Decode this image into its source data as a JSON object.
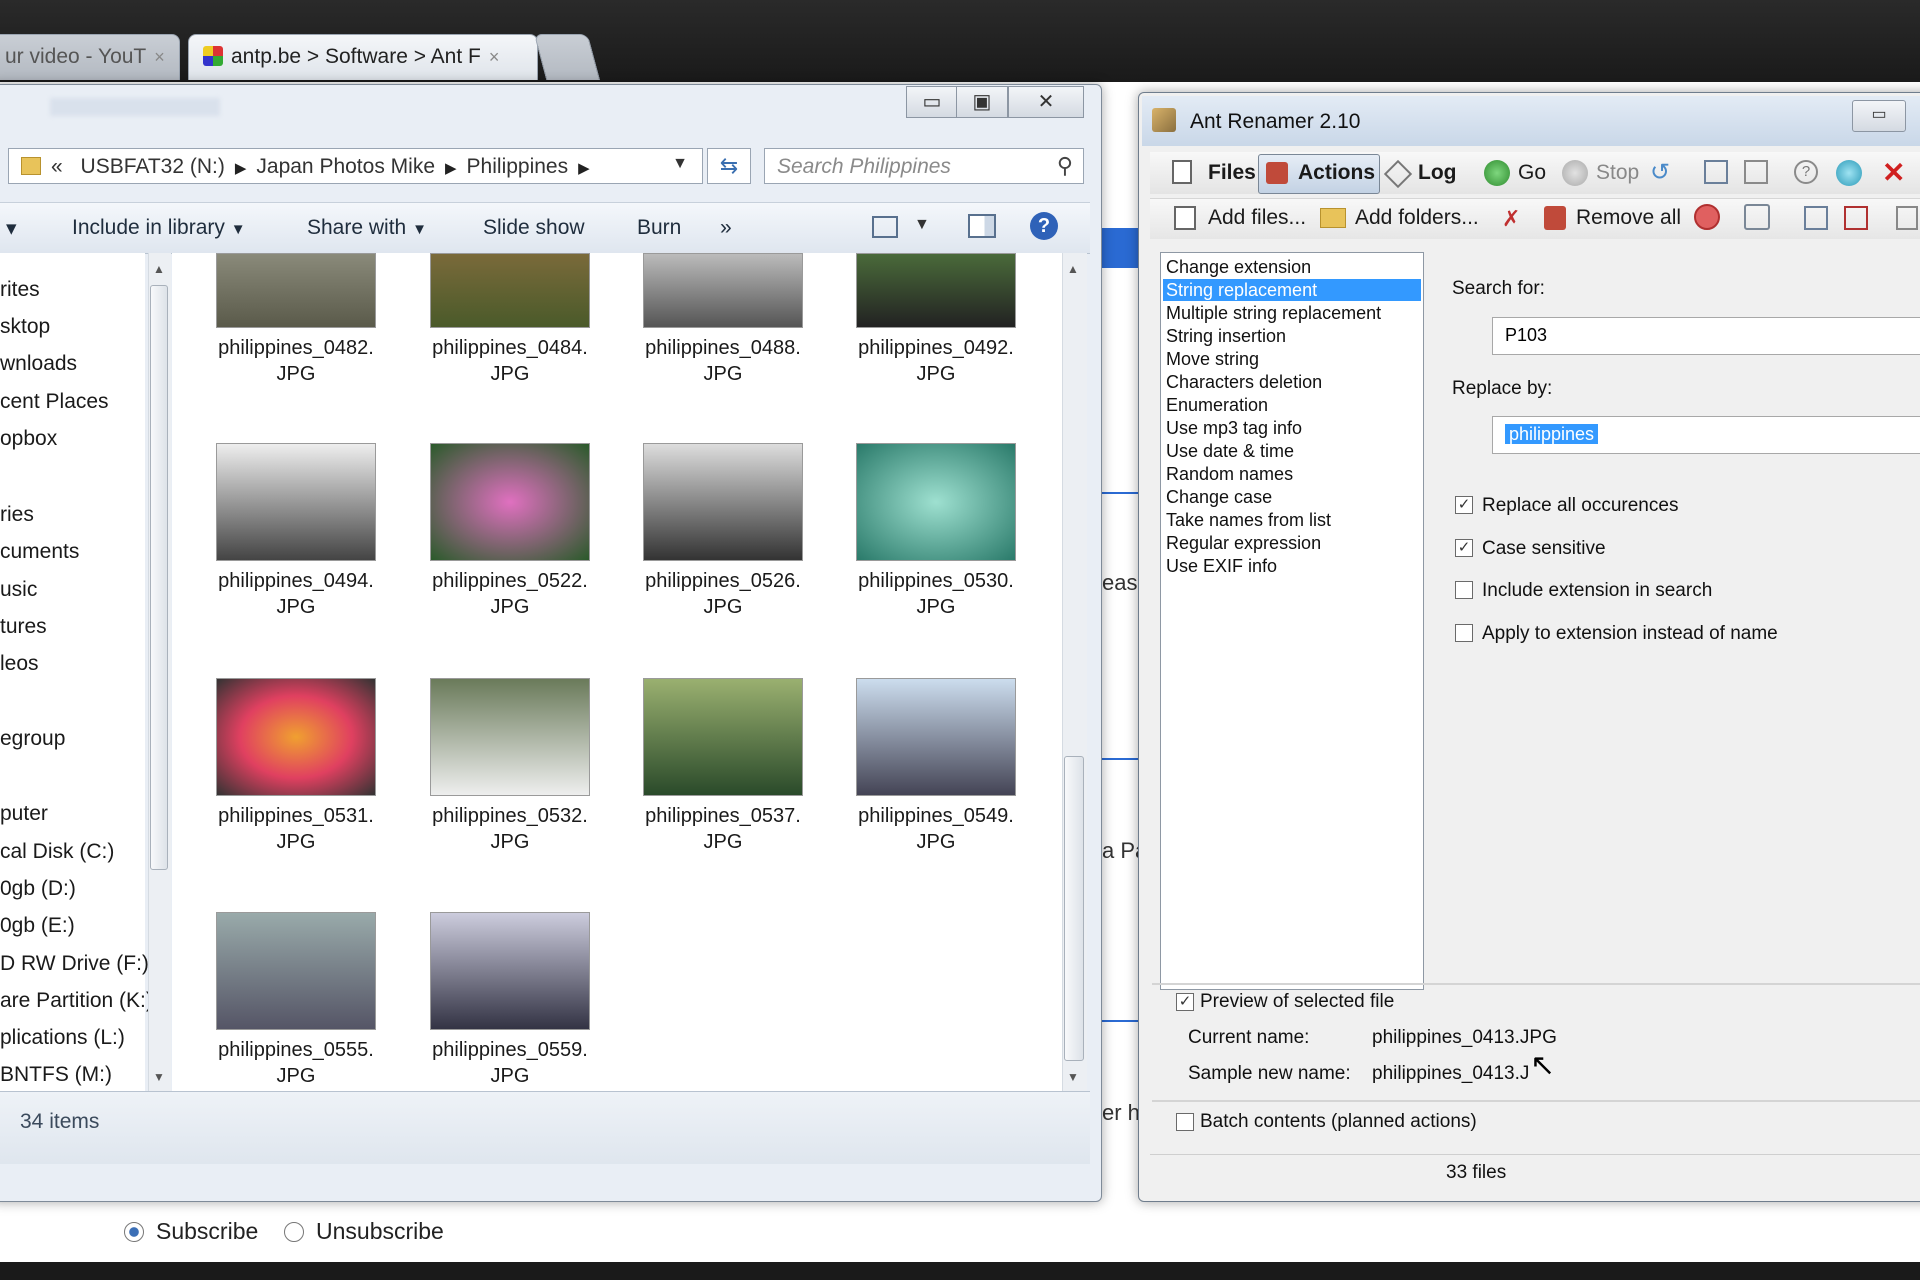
{
  "browser": {
    "tabs": [
      {
        "label": "ur video - YouT"
      },
      {
        "label": "antp.be > Software > Ant F"
      }
    ],
    "close_glyph": "×"
  },
  "explorer": {
    "caption_min": "▭",
    "caption_max": "▣",
    "caption_close": "✕",
    "address": {
      "back": "«",
      "parts": [
        "USBFAT32 (N:)",
        "Japan Photos Mike",
        "Philippines"
      ]
    },
    "search_placeholder": "Search Philippines",
    "commands": {
      "include": "Include in library",
      "share": "Share with",
      "slideshow": "Slide show",
      "burn": "Burn",
      "more": "»"
    },
    "nav_items": [
      "rites",
      "sktop",
      "wnloads",
      "cent Places",
      "opbox",
      "ries",
      "cuments",
      "usic",
      "tures",
      "leos",
      "egroup",
      "puter",
      "cal Disk (C:)",
      "0gb (D:)",
      "0gb (E:)",
      "D RW Drive (F:)",
      "are Partition (K:)",
      "plications (L:)",
      "BNTFS (M:)"
    ],
    "files": [
      {
        "name": "philippines_0482.",
        "ext": "JPG"
      },
      {
        "name": "philippines_0484.",
        "ext": "JPG"
      },
      {
        "name": "philippines_0488.",
        "ext": "JPG"
      },
      {
        "name": "philippines_0492.",
        "ext": "JPG"
      },
      {
        "name": "philippines_0494.",
        "ext": "JPG"
      },
      {
        "name": "philippines_0522.",
        "ext": "JPG"
      },
      {
        "name": "philippines_0526.",
        "ext": "JPG"
      },
      {
        "name": "philippines_0530.",
        "ext": "JPG"
      },
      {
        "name": "philippines_0531.",
        "ext": "JPG"
      },
      {
        "name": "philippines_0532.",
        "ext": "JPG"
      },
      {
        "name": "philippines_0537.",
        "ext": "JPG"
      },
      {
        "name": "philippines_0549.",
        "ext": "JPG"
      },
      {
        "name": "philippines_0555.",
        "ext": "JPG"
      },
      {
        "name": "philippines_0559.",
        "ext": "JPG"
      }
    ],
    "status": "34 items"
  },
  "ant": {
    "title": "Ant Renamer 2.10",
    "toolbar1": {
      "files": "Files",
      "actions": "Actions",
      "log": "Log",
      "go": "Go",
      "stop": "Stop"
    },
    "toolbar2": {
      "add_files": "Add files...",
      "add_folders": "Add folders...",
      "remove_all": "Remove all"
    },
    "actions": [
      "Change extension",
      "String replacement",
      "Multiple string replacement",
      "String insertion",
      "Move string",
      "Characters deletion",
      "Enumeration",
      "Use mp3 tag info",
      "Use date & time",
      "Random names",
      "Change case",
      "Take names from list",
      "Regular expression",
      "Use EXIF info"
    ],
    "selected_action_index": 1,
    "search_label": "Search for:",
    "search_value": "P103",
    "replace_label": "Replace by:",
    "replace_value": "philippines",
    "options": {
      "replace_all": "Replace all occurences",
      "case_sensitive": "Case sensitive",
      "include_ext": "Include extension in search",
      "apply_ext": "Apply to extension instead of name"
    },
    "preview_label": "Preview of selected file",
    "current_name_label": "Current name:",
    "current_name": "philippines_0413.JPG",
    "sample_name_label": "Sample new name:",
    "sample_name": "philippines_0413.J",
    "batch_label": "Batch contents (planned actions)",
    "file_count": "33 files"
  },
  "page_behind": {
    "frag1": "eas",
    "frag2": "a Pa",
    "frag3": "er h",
    "subscribe": "Subscribe",
    "unsubscribe": "Unsubscribe"
  },
  "colors": {
    "selection": "#3399ff",
    "accent_blue": "#2a6ad3"
  }
}
